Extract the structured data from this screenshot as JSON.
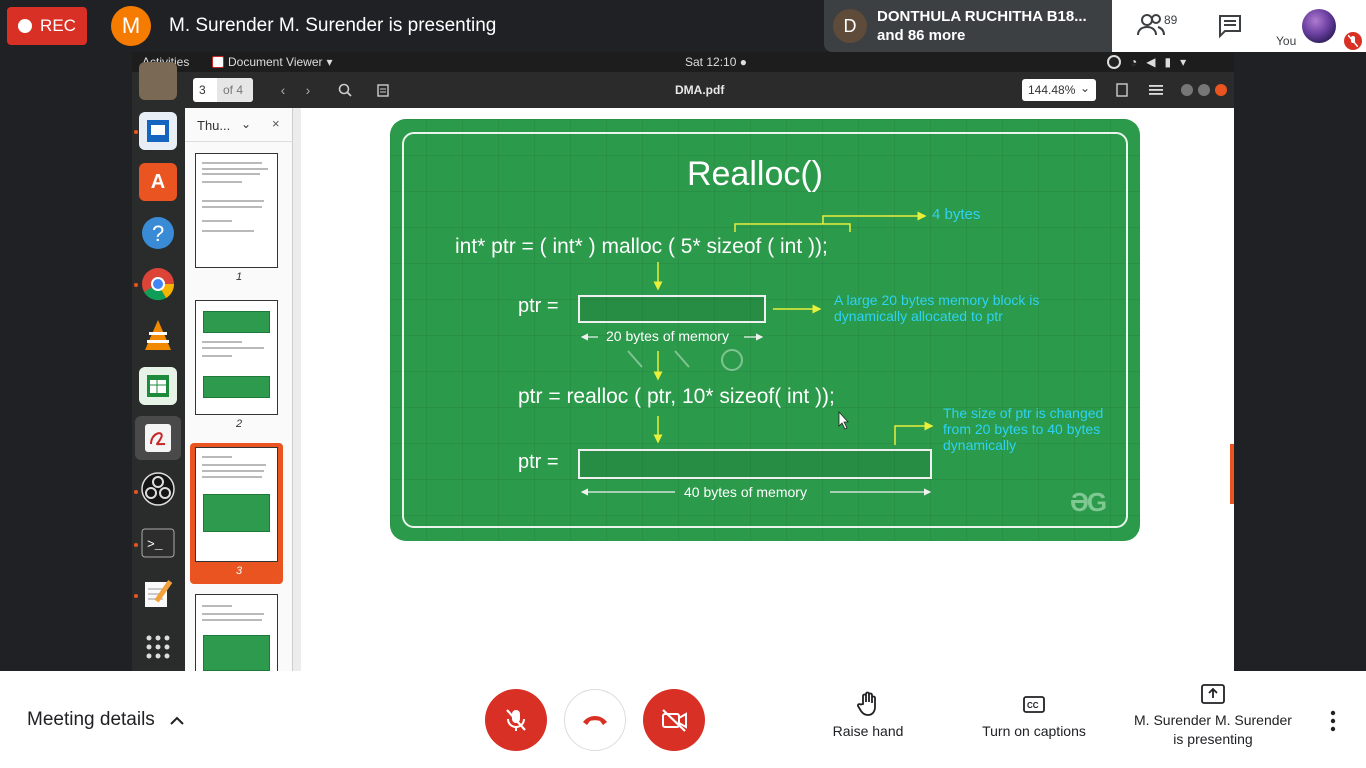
{
  "meet": {
    "rec_label": "REC",
    "presenter_initial": "M",
    "presenter_text": "M. Surender M. Surender is presenting",
    "participant_initial": "D",
    "participant_name": "DONTHULA RUCHITHA B18...",
    "participant_more": "and 86 more",
    "people_count": "89",
    "you_label": "You",
    "meeting_details": "Meeting details",
    "raise_hand": "Raise hand",
    "captions": "Turn on captions",
    "presenting_line1": "M. Surender M. Surender",
    "presenting_line2": "is presenting",
    "mic_state": "muted",
    "camera_state": "off"
  },
  "desktop": {
    "activities": "Activities",
    "app_menu": "Document Viewer",
    "clock": "Sat 12:10",
    "dock_icons": [
      "rhythmbox-icon",
      "libreoffice-impress-icon",
      "software-center-icon",
      "help-icon",
      "chrome-icon",
      "vlc-icon",
      "libreoffice-calc-icon",
      "document-viewer-icon",
      "obs-icon",
      "terminal-icon",
      "text-editor-icon",
      "app-grid-icon"
    ]
  },
  "viewer": {
    "current_page": "3",
    "page_total": "of 4",
    "file_title": "DMA.pdf",
    "zoom": "144.48%",
    "sidebar_mode": "Thu...",
    "thumb_labels": [
      "1",
      "2",
      "3"
    ],
    "selected_page": "3"
  },
  "slide": {
    "title": "Realloc()",
    "line1": "int* ptr = ( int* ) malloc ( 5* sizeof ( int ));",
    "bytes_note": "4 bytes",
    "ptr_label": "ptr =",
    "mem20": "20 bytes of memory",
    "note20_line1": "A large 20 bytes memory block is",
    "note20_line2": "dynamically allocated to ptr",
    "line2": "ptr = realloc ( ptr, 10* sizeof( int ));",
    "note40_line1": "The size of ptr is changed",
    "note40_line2": "from 20 bytes to 40 bytes",
    "note40_line3": "dynamically",
    "mem40": "40 bytes of memory",
    "logo": "ƏG"
  }
}
